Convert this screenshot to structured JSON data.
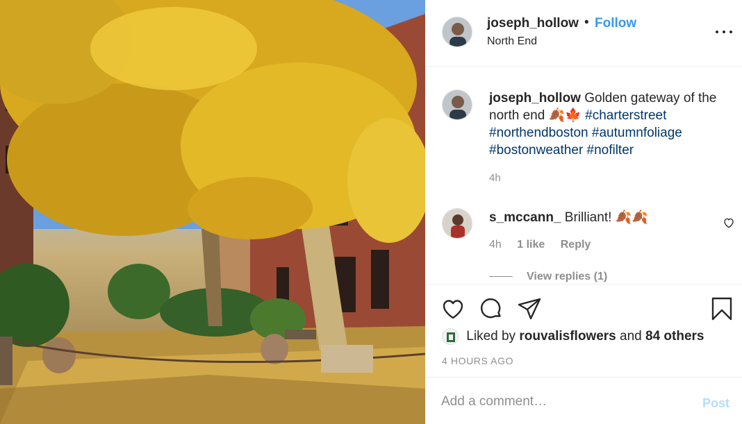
{
  "post": {
    "image_alt": "Golden autumn trees over a brick-lined street",
    "header": {
      "username": "joseph_hollow",
      "separator": "•",
      "follow_label": "Follow",
      "location": "North End",
      "more_icon": "more-horizontal-icon"
    },
    "caption": {
      "username": "joseph_hollow",
      "text": "Golden gateway of the north end 🍂🍁",
      "hashtags": [
        "#charterstreet",
        "#northendboston",
        "#autumnfoliage",
        "#bostonweather",
        "#nofilter"
      ],
      "time": "4h"
    },
    "comment": {
      "username": "s_mccann_",
      "text": "Brilliant! 🍂🍂",
      "time": "4h",
      "likes": "1 like",
      "reply_label": "Reply",
      "view_replies": "View replies (1)",
      "like_icon": "heart-outline-icon"
    },
    "actions": {
      "icons": [
        "heart-icon",
        "comment-icon",
        "share-icon",
        "bookmark-icon"
      ],
      "liked_prefix": "Liked by",
      "liked_user": "rouvalisflowers",
      "liked_and": "and",
      "liked_others": "84 others",
      "timestamp": "4 HOURS AGO"
    },
    "add_comment": {
      "placeholder": "Add a comment…",
      "post_label": "Post"
    }
  },
  "colors": {
    "link_blue": "#3897f0",
    "hashtag": "#00376b",
    "muted": "#8e8e8e",
    "post_disabled": "#b2dffc"
  }
}
